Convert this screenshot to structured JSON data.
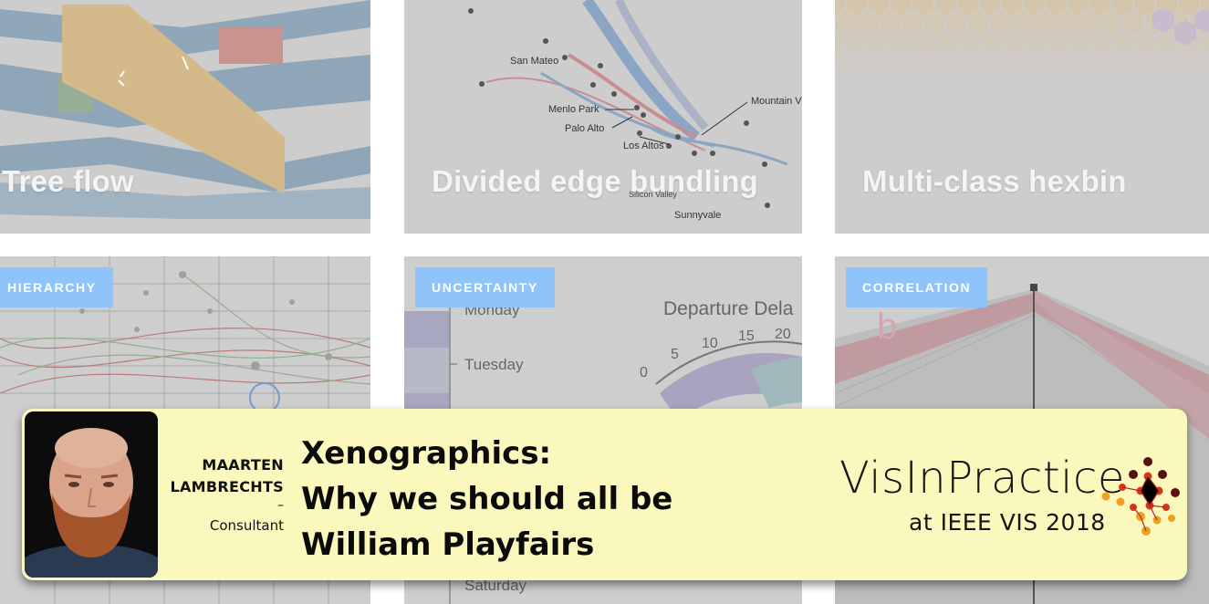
{
  "cards": {
    "tree_flow": {
      "title": "Tree flow"
    },
    "edge_bundling": {
      "title": "Divided edge bundling",
      "map_labels": [
        "San Mateo",
        "Menlo Park",
        "Palo Alto",
        "Los Altos",
        "Mountain V",
        "Silicon Valley",
        "Sunnyvale"
      ]
    },
    "hexbin": {
      "title": "Multi-class hexbin"
    },
    "hierarchy": {
      "tag": "HIERARCHY"
    },
    "uncertainty": {
      "tag": "UNCERTAINTY",
      "days": [
        "Monday",
        "Tuesday",
        "Saturday"
      ],
      "gauge_title": "Departure Dela",
      "gauge_ticks": [
        "0",
        "5",
        "10",
        "15",
        "20"
      ]
    },
    "correlation": {
      "tag": "CORRELATION",
      "panel_letter": "b"
    }
  },
  "banner": {
    "presenter_first": "MAARTEN",
    "presenter_last": "LAMBRECHTS",
    "separator": "–",
    "presenter_role": "Consultant",
    "talk_line1": "Xenographics:",
    "talk_line2": "Why we should all be",
    "talk_line3": "William Playfairs",
    "logo_main": "VisInPractice",
    "logo_sub": "at IEEE VIS 2018"
  },
  "colors": {
    "card_bg": "#cfcfcf",
    "tag_bg": "#8fc4fb",
    "banner_bg": "#fbf8bd",
    "logo_orange": "#f0a020",
    "logo_red": "#d8361c",
    "logo_dark": "#5a1010"
  }
}
